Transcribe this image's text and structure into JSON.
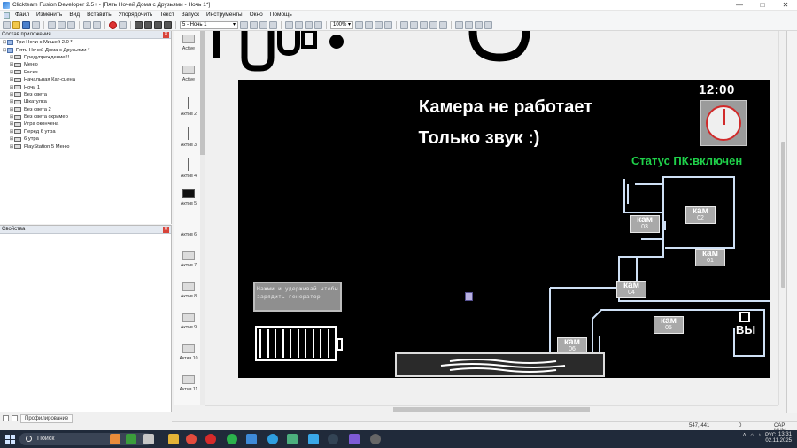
{
  "window": {
    "title": "Clickteam Fusion Developer 2.5+ - [Пять Ночей Дома с Друзьями - Ночь 1*]",
    "controls": [
      "—",
      "□",
      "✕"
    ]
  },
  "menu": [
    "Файл",
    "Изменить",
    "Вид",
    "Вставить",
    "Упорядочить",
    "Текст",
    "Запуск",
    "Инструменты",
    "Окно",
    "Помощь"
  ],
  "toolbar": {
    "frame_select": "5 - Ночь 1",
    "zoom_select": "100%"
  },
  "workspace": {
    "title": "Состав приложения",
    "items": [
      {
        "label": "Три Ночи с Мишей 2.0 *",
        "level": 0,
        "exp": "⊟",
        "type": "app"
      },
      {
        "label": "Пять Ночей Дома с Друзьями *",
        "level": 0,
        "exp": "⊟",
        "type": "app"
      },
      {
        "label": "Предупреждение!!!",
        "level": 1,
        "exp": "⊞",
        "type": "frame"
      },
      {
        "label": "Меню",
        "level": 1,
        "exp": "⊞",
        "type": "frame"
      },
      {
        "label": "Faces",
        "level": 1,
        "exp": "⊞",
        "type": "frame"
      },
      {
        "label": "Начальная Кат-сцена",
        "level": 1,
        "exp": "⊞",
        "type": "frame"
      },
      {
        "label": "Ночь 1",
        "level": 1,
        "exp": "⊞",
        "type": "frame"
      },
      {
        "label": "Без света",
        "level": 1,
        "exp": "⊞",
        "type": "frame"
      },
      {
        "label": "Шкатулка",
        "level": 1,
        "exp": "⊞",
        "type": "frame"
      },
      {
        "label": "Без света 2",
        "level": 1,
        "exp": "⊞",
        "type": "frame"
      },
      {
        "label": "Без света скример",
        "level": 1,
        "exp": "⊞",
        "type": "frame"
      },
      {
        "label": "Игра окончена",
        "level": 1,
        "exp": "⊞",
        "type": "frame"
      },
      {
        "label": "Перед 6 утра",
        "level": 1,
        "exp": "⊞",
        "type": "frame"
      },
      {
        "label": "6 утра",
        "level": 1,
        "exp": "⊞",
        "type": "frame"
      },
      {
        "label": "PlayStation 5 Меню",
        "level": 1,
        "exp": "⊞",
        "type": "frame"
      }
    ]
  },
  "properties": {
    "title": "Свойства"
  },
  "framelist": {
    "items": [
      {
        "label": "Active",
        "thumb": "plain"
      },
      {
        "label": "Active",
        "thumb": "plain"
      },
      {
        "label": "Актив 2",
        "thumb": "line"
      },
      {
        "label": "Актив 3",
        "thumb": "line"
      },
      {
        "label": "Актив 4",
        "thumb": "line"
      },
      {
        "label": "Актив 5",
        "thumb": "black"
      },
      {
        "label": "Актив 6",
        "thumb": "none"
      },
      {
        "label": "Актив 7",
        "thumb": "plain"
      },
      {
        "label": "Актив 8",
        "thumb": "plain"
      },
      {
        "label": "Актив 9",
        "thumb": "plain"
      },
      {
        "label": "Актив 10",
        "thumb": "plain"
      },
      {
        "label": "Актив 11",
        "thumb": "plain"
      }
    ]
  },
  "game": {
    "clock": "12:00",
    "camera_msg_1": "Камера не работает",
    "camera_msg_2": "Только звук :)",
    "pc_status": "Статус ПК:включен",
    "generator_hint": "Нажми и удерживай чтобы зарядить генератор",
    "exit_label": "ВЫ",
    "battery_cells": 10,
    "cams": [
      {
        "label": "кам",
        "num": "02"
      },
      {
        "label": "кам",
        "num": "03"
      },
      {
        "label": "кам",
        "num": "01"
      },
      {
        "label": "кам",
        "num": "04"
      },
      {
        "label": "кам",
        "num": "05"
      },
      {
        "label": "кам",
        "num": "06"
      }
    ]
  },
  "bottom_tabs": {
    "profiling": "Профилирование"
  },
  "status": {
    "coords": "547, 441",
    "zero": "0",
    "caps": "CAP NUM"
  },
  "taskbar": {
    "search": "Поиск",
    "lang": "РУС",
    "time": "13:31",
    "date": "02.11.2025"
  }
}
